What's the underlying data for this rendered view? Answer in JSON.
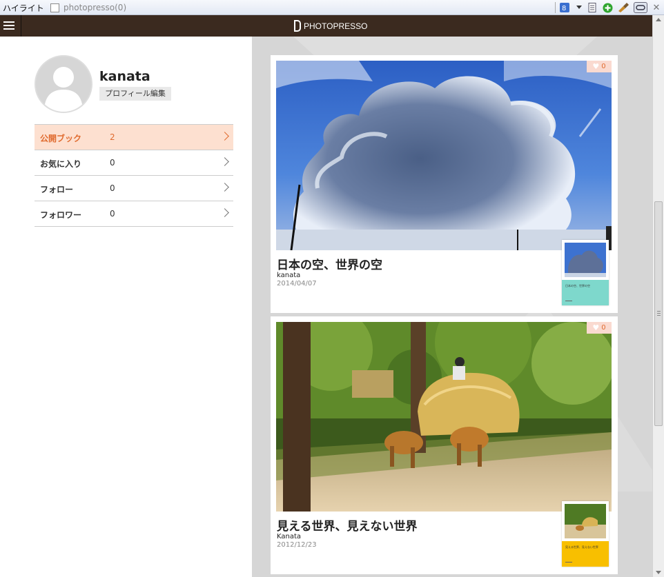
{
  "toolbar": {
    "highlight_label": "ハイライト",
    "tab_label": "photopresso(0)"
  },
  "header": {
    "logo_text": "PHOTOPRESSO"
  },
  "profile": {
    "username": "kanata",
    "edit_label": "プロフィール編集"
  },
  "stats": [
    {
      "label": "公開ブック",
      "count": "2",
      "active": true
    },
    {
      "label": "お気に入り",
      "count": "0",
      "active": false
    },
    {
      "label": "フォロー",
      "count": "0",
      "active": false
    },
    {
      "label": "フォロワー",
      "count": "0",
      "active": false
    }
  ],
  "books": [
    {
      "title": "日本の空、世界の空",
      "author": "kanata",
      "date": "2014/04/07",
      "likes": "0",
      "thumb_title": "日本の空、世界の空",
      "cover_color": "#7ed8cc"
    },
    {
      "title": "見える世界、見えない世界",
      "author": "Kanata",
      "date": "2012/12/23",
      "likes": "0",
      "thumb_title": "見える世界、見えない世界",
      "cover_color": "#f8bf00"
    }
  ],
  "colors": {
    "header_bg": "#3b2a1f",
    "accent": "#e06b2f",
    "active_row_bg": "#fde0d0"
  }
}
